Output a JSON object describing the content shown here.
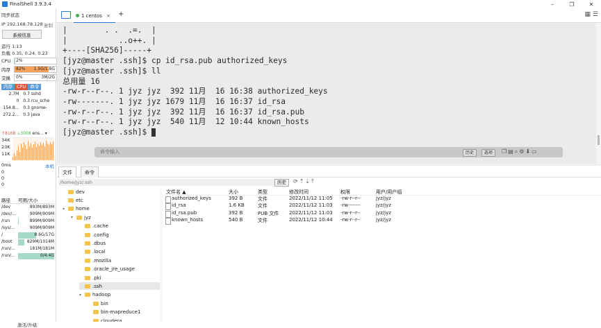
{
  "app": {
    "title": "FinalShell 3.9.3.4"
  },
  "left": {
    "sync": "同步状态",
    "ip": "IP 192.168.78.128",
    "copy": "复制",
    "sys_btn": "系统信息",
    "uptime": "运行 1:13",
    "load": "负载 0.35, 0.24, 0.23",
    "cpu": {
      "label": "CPU",
      "value": "2%",
      "fraction": 0.02
    },
    "mem": {
      "label": "内存",
      "value": "82%",
      "detail": "1.5G/1.8G",
      "fraction": 0.82
    },
    "swap": {
      "label": "交换",
      "value": "0%",
      "detail": "3M/2G",
      "fraction": 0.0
    },
    "proc_tabs": [
      "内存",
      "CPU",
      "命令"
    ],
    "procs": [
      {
        "mem": "2.7M",
        "cpu": "0.7",
        "cmd": "sshd"
      },
      {
        "mem": "0",
        "cpu": "0.3",
        "cmd": "rcu_sche"
      },
      {
        "mem": "154.8...",
        "cpu": "0.3",
        "cmd": "gnome-"
      },
      {
        "mem": "272.2...",
        "cpu": "0.3",
        "cmd": "java"
      }
    ],
    "net": {
      "up": "↑8168",
      "down": "↓3008",
      "iface": "ens..."
    },
    "net_labels": [
      "34K",
      "23K",
      "11K"
    ],
    "ping": {
      "latency": "0ms",
      "host": "本机"
    },
    "ping_vals": [
      "0",
      "0",
      "0"
    ],
    "disk_head": [
      "路径",
      "可用/大小"
    ],
    "disks": [
      {
        "path": "/dev",
        "size": "893M/893M",
        "fraction": 0.0
      },
      {
        "path": "/dev/...",
        "size": "909M/909M",
        "fraction": 0.0
      },
      {
        "path": "/run",
        "size": "899M/909M",
        "fraction": 0.02
      },
      {
        "path": "/sys/...",
        "size": "909M/909M",
        "fraction": 0.0
      },
      {
        "path": "/",
        "size": "8.6G/17G",
        "fraction": 0.5
      },
      {
        "path": "/boot",
        "size": "829M/1014M",
        "fraction": 0.18
      },
      {
        "path": "/run/...",
        "size": "181M/181M",
        "fraction": 0.0
      },
      {
        "path": "/run/...",
        "size": "0/4.4G",
        "fraction": 1.0
      }
    ],
    "upgrade": "激活/升级"
  },
  "tabs": {
    "session": "1 centos",
    "close": "×",
    "add": "+"
  },
  "terminal": {
    "lines": [
      "|        . .  .=.  |",
      "|           ..o++. |",
      "+----[SHA256]-----+",
      "[jyz@master .ssh]$ cp id_rsa.pub authorized_keys",
      "[jyz@master .ssh]$ ll",
      "总用量 16",
      "-rw-r--r--. 1 jyz jyz  392 11月  16 16:38 authorized_keys",
      "-rw-------. 1 jyz jyz 1679 11月  16 16:37 id_rsa",
      "-rw-r--r--. 1 jyz jyz  392 11月  16 16:37 id_rsa.pub",
      "-rw-r--r--. 1 jyz jyz  540 11月  12 10:44 known_hosts"
    ],
    "prompt": "[jyz@master .ssh]$ ",
    "cmd_placeholder": "命令输入",
    "history_btn": "历史",
    "options_btn": "选项"
  },
  "files": {
    "tabs": [
      "文件",
      "命令"
    ],
    "path": "/home/jyz/.ssh",
    "history_btn": "历史",
    "tree": [
      {
        "name": "dev",
        "depth": 1
      },
      {
        "name": "etc",
        "depth": 1
      },
      {
        "name": "home",
        "depth": 1,
        "open": true
      },
      {
        "name": "jyz",
        "depth": 2,
        "open": true
      },
      {
        "name": ".cache",
        "depth": 3
      },
      {
        "name": ".config",
        "depth": 3
      },
      {
        "name": ".dbus",
        "depth": 3
      },
      {
        "name": ".local",
        "depth": 3
      },
      {
        "name": ".mozilla",
        "depth": 3
      },
      {
        "name": ".oracle_jre_usage",
        "depth": 3
      },
      {
        "name": ".pki",
        "depth": 3
      },
      {
        "name": ".ssh",
        "depth": 3,
        "selected": true
      },
      {
        "name": "hadoop",
        "depth": 3,
        "open": true
      },
      {
        "name": "bin",
        "depth": 4
      },
      {
        "name": "bin-mapreduce1",
        "depth": 4
      },
      {
        "name": "cloudera",
        "depth": 4
      }
    ],
    "columns": [
      "文件名 ▲",
      "大小",
      "类型",
      "修改时间",
      "权限",
      "用户/用户组"
    ],
    "rows": [
      {
        "name": "authorized_keys",
        "size": "392 B",
        "type": "文件",
        "mtime": "2022/11/12 11:05",
        "perm": "-rw-r--r--",
        "owner": "jyz/jyz"
      },
      {
        "name": "id_rsa",
        "size": "1.6 KB",
        "type": "文件",
        "mtime": "2022/11/12 11:03",
        "perm": "-rw-------",
        "owner": "jyz/jyz"
      },
      {
        "name": "id_rsa.pub",
        "size": "392 B",
        "type": "PUB 文件",
        "mtime": "2022/11/12 11:03",
        "perm": "-rw-r--r--",
        "owner": "jyz/jyz"
      },
      {
        "name": "known_hosts",
        "size": "540 B",
        "type": "文件",
        "mtime": "2022/11/12 10:44",
        "perm": "-rw-r--r--",
        "owner": "jyz/jyz"
      }
    ]
  },
  "colors": {
    "accent": "#2b79d6",
    "mem_fill": "#f5a15c",
    "cpu_fill": "#a6d9c9",
    "disk_fill": "#a6d9c9",
    "net_bar": "#f5a15c"
  }
}
